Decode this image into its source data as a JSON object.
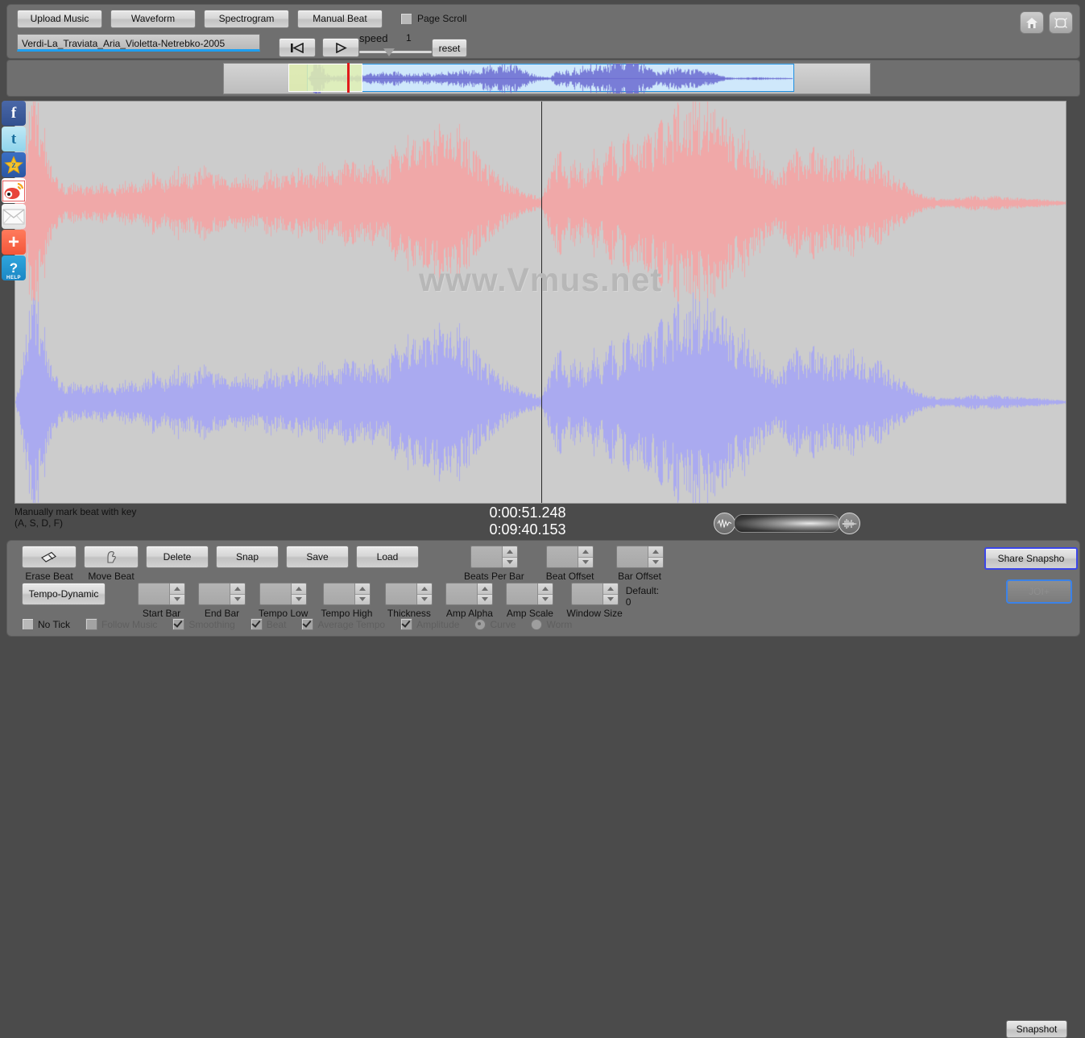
{
  "header": {
    "tabs": [
      {
        "id": "upload-music",
        "label": "Upload Music"
      },
      {
        "id": "waveform",
        "label": "Waveform"
      },
      {
        "id": "spectrogram",
        "label": "Spectrogram"
      },
      {
        "id": "manual-beat",
        "label": "Manual Beat"
      }
    ],
    "page_scroll": {
      "label": "Page Scroll",
      "checked": false
    },
    "file_name": "Verdi-La_Traviata_Aria_Violetta-Netrebko-2005",
    "transport": {
      "rewind_icon": "skip-to-start-icon",
      "play_icon": "play-icon"
    },
    "speed": {
      "label": "speed",
      "value": "1",
      "reset_label": "reset"
    },
    "window_icons": [
      {
        "id": "home",
        "icon": "home-icon"
      },
      {
        "id": "fullscreen",
        "icon": "fullscreen-icon"
      }
    ]
  },
  "social": [
    {
      "id": "facebook",
      "glyph": "f",
      "icon": "facebook-icon"
    },
    {
      "id": "twitter",
      "glyph": "t",
      "icon": "twitter-icon"
    },
    {
      "id": "qzone",
      "glyph": "★",
      "icon": "qzone-star-icon"
    },
    {
      "id": "weibo",
      "glyph": "",
      "icon": "weibo-icon"
    },
    {
      "id": "email",
      "glyph": "",
      "icon": "email-icon"
    },
    {
      "id": "more",
      "glyph": "+",
      "icon": "more-share-icon"
    },
    {
      "id": "help",
      "glyph": "?",
      "sub": "HELP",
      "icon": "help-icon"
    }
  ],
  "waveform": {
    "watermark": "www.Vmus.net",
    "top_color": "#f0a8a8",
    "bottom_color": "#aaaaf0",
    "background": "#cccccc",
    "playhead_color": "#e01b1b"
  },
  "status": {
    "hint_line1": "Manually mark beat with key",
    "hint_line2": "(A, S, D, F)",
    "current_time": "0:00:51.248",
    "total_time": "0:09:40.153",
    "volume_low_icon": "waveform-low-icon",
    "volume_high_icon": "waveform-high-icon",
    "snapshot_label": "Snapshot"
  },
  "bottom": {
    "row1": [
      {
        "id": "erase-beat",
        "type": "iconbutton",
        "icon": "eraser-icon",
        "caption": "Erase Beat"
      },
      {
        "id": "move-beat",
        "type": "iconbutton",
        "icon": "hand-move-icon",
        "caption": "Move Beat"
      },
      {
        "id": "delete",
        "type": "button",
        "label": "Delete",
        "caption": ""
      },
      {
        "id": "snap",
        "type": "button",
        "label": "Snap",
        "caption": ""
      },
      {
        "id": "save",
        "type": "button",
        "label": "Save",
        "caption": ""
      },
      {
        "id": "load",
        "type": "button",
        "label": "Load",
        "caption": ""
      },
      {
        "id": "beats-per-bar",
        "type": "spinner",
        "value": "",
        "caption": "Beats Per Bar"
      },
      {
        "id": "beat-offset",
        "type": "spinner",
        "value": "",
        "caption": "Beat Offset"
      },
      {
        "id": "bar-offset",
        "type": "spinner",
        "value": "",
        "caption": "Bar Offset"
      }
    ],
    "tempo_dynamic_label": "Tempo-Dynamic",
    "row2": [
      {
        "id": "start-bar",
        "value": "",
        "caption": "Start Bar"
      },
      {
        "id": "end-bar",
        "value": "",
        "caption": "End Bar"
      },
      {
        "id": "tempo-low",
        "value": "",
        "caption": "Tempo Low"
      },
      {
        "id": "tempo-high",
        "value": "",
        "caption": "Tempo High"
      },
      {
        "id": "thickness",
        "value": "",
        "caption": "Thickness"
      },
      {
        "id": "amp-alpha",
        "value": "",
        "caption": "Amp Alpha"
      },
      {
        "id": "amp-scale",
        "value": "",
        "caption": "Amp Scale"
      },
      {
        "id": "window-size",
        "value": "",
        "caption": "Window Size"
      }
    ],
    "default_label": "Default:",
    "default_value": "0",
    "checkboxes": [
      {
        "id": "no-tick",
        "label": "No Tick",
        "checked": false,
        "dim": false,
        "type": "check"
      },
      {
        "id": "follow-music",
        "label": "Follow Music",
        "checked": false,
        "dim": true,
        "type": "check"
      },
      {
        "id": "smoothing",
        "label": "Smoothing",
        "checked": true,
        "dim": true,
        "type": "check"
      },
      {
        "id": "beat",
        "label": "Beat",
        "checked": true,
        "dim": true,
        "type": "check"
      },
      {
        "id": "average-tempo",
        "label": "Average Tempo",
        "checked": true,
        "dim": true,
        "type": "check"
      },
      {
        "id": "amplitude",
        "label": "Amplitude",
        "checked": true,
        "dim": true,
        "type": "check"
      },
      {
        "id": "curve",
        "label": "Curve",
        "checked": true,
        "dim": true,
        "type": "radio"
      },
      {
        "id": "worm",
        "label": "Worm",
        "checked": false,
        "dim": true,
        "type": "radio"
      }
    ],
    "share_snapshot_label": "Share Snapsho",
    "join_label": "JOI+"
  }
}
